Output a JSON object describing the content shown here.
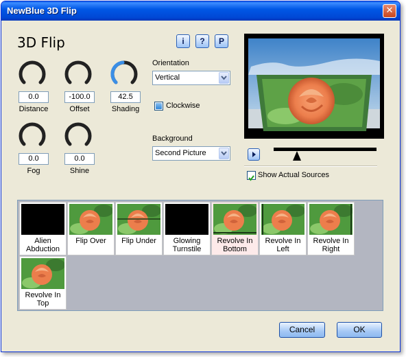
{
  "window": {
    "title": "NewBlue 3D Flip"
  },
  "header": {
    "title": "3D Flip",
    "info_label": "i",
    "help_label": "?",
    "presets_label": "P"
  },
  "knobs": [
    {
      "label": "Distance",
      "value": "0.0",
      "level": 0.0
    },
    {
      "label": "Offset",
      "value": "-100.0",
      "level": 0.0
    },
    {
      "label": "Shading",
      "value": "42.5",
      "level": 0.43
    },
    {
      "label": "Fog",
      "value": "0.0",
      "level": 0.0
    },
    {
      "label": "Shine",
      "value": "0.0",
      "level": 0.0
    }
  ],
  "orientation": {
    "label": "Orientation",
    "value": "Vertical"
  },
  "clockwise": {
    "label": "Clockwise",
    "checked": false
  },
  "background": {
    "label": "Background",
    "value": "Second Picture"
  },
  "preview": {
    "position": 0.2
  },
  "show_sources": {
    "label": "Show Actual Sources",
    "checked": true
  },
  "presets": [
    {
      "label": "Alien Abduction",
      "thumb": "black"
    },
    {
      "label": "Flip Over",
      "thumb": "rose"
    },
    {
      "label": "Flip Under",
      "thumb": "rose"
    },
    {
      "label": "Glowing Turnstile",
      "thumb": "black"
    },
    {
      "label": "Revolve In Bottom",
      "thumb": "rose",
      "selected": true
    },
    {
      "label": "Revolve In Left",
      "thumb": "rose"
    },
    {
      "label": "Revolve In Right",
      "thumb": "rose"
    },
    {
      "label": "Revolve In Top",
      "thumb": "rose"
    }
  ],
  "buttons": {
    "cancel": "Cancel",
    "ok": "OK"
  },
  "colors": {
    "titlebar": "#0054e3",
    "dialog_bg": "#ece9d8",
    "knob_active": "#3a8ee6",
    "gallery_bg": "#b3b6c1"
  }
}
